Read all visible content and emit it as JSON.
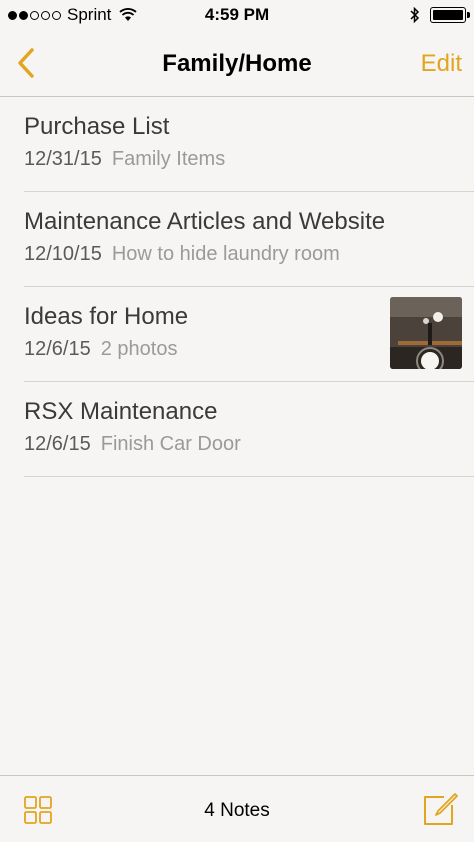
{
  "status": {
    "carrier": "Sprint",
    "time": "4:59 PM",
    "signal_bars": 2,
    "battery_level": 1.0
  },
  "nav": {
    "title": "Family/Home",
    "edit_label": "Edit",
    "back_icon": "chevron-left-icon"
  },
  "notes": [
    {
      "title": "Purchase List",
      "date": "12/31/15",
      "preview": "Family Items"
    },
    {
      "title": "Maintenance Articles and Website",
      "date": "12/10/15",
      "preview": "How to hide laundry room"
    },
    {
      "title": "Ideas for Home",
      "date": "12/6/15",
      "preview": "2 photos"
    },
    {
      "title": "RSX Maintenance",
      "date": "12/6/15",
      "preview": "Finish Car Door"
    }
  ],
  "toolbar": {
    "count_label": "4 Notes",
    "attachments_icon": "grid-icon",
    "compose_icon": "compose-icon"
  },
  "colors": {
    "accent": "#e2a51f",
    "background": "#f6f5f3"
  }
}
